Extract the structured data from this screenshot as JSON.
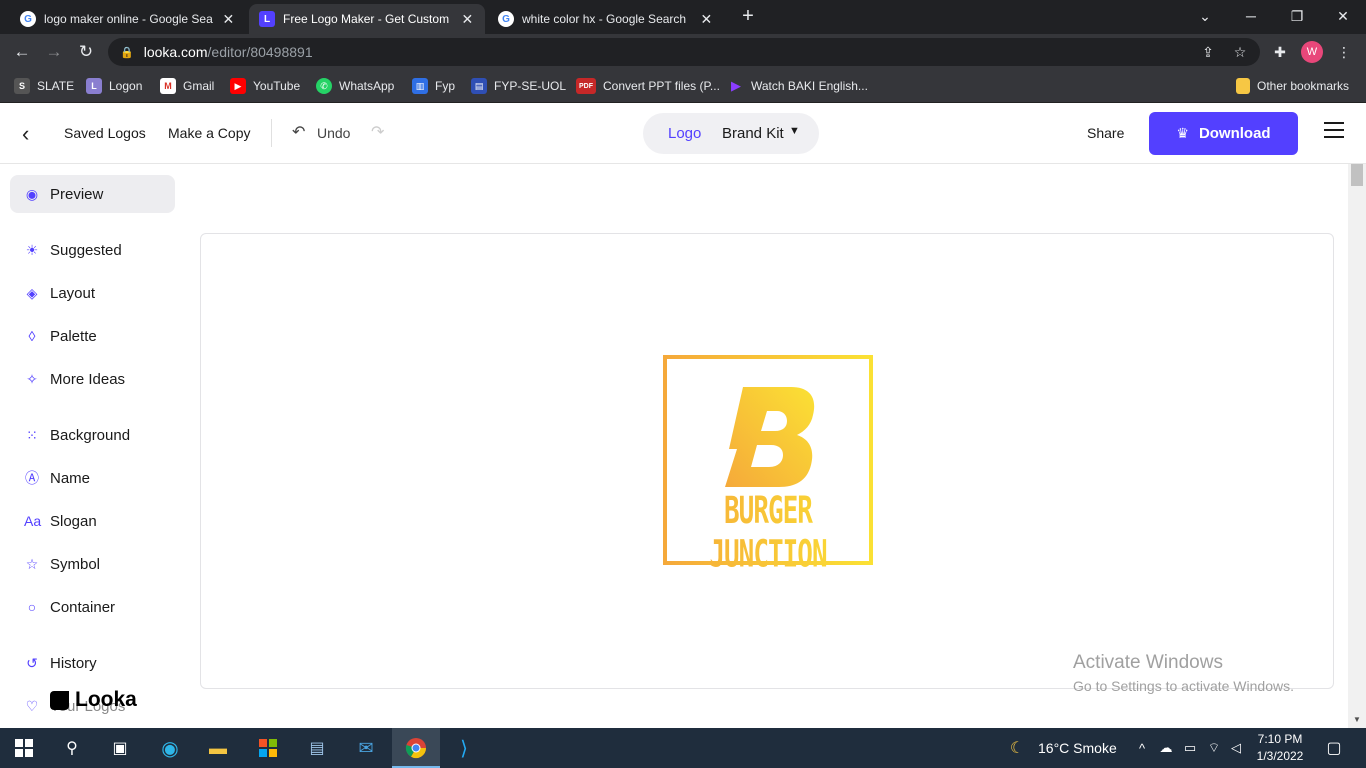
{
  "browser": {
    "tabs": [
      {
        "title": "logo maker online - Google Search",
        "favicon": "google-icon"
      },
      {
        "title": "Free Logo Maker - Get Custom Logo",
        "favicon": "looka-icon"
      },
      {
        "title": "white color hx - Google Search",
        "favicon": "google-icon"
      }
    ],
    "url_host": "looka.com",
    "url_path": "/editor/80498891",
    "profile_initial": "W",
    "bookmarks": [
      "SLATE",
      "Logon",
      "Gmail",
      "YouTube",
      "WhatsApp",
      "Fyp",
      "FYP-SE-UOL",
      "Convert PPT files (P...",
      "Watch BAKI English..."
    ],
    "other_bookmarks": "Other bookmarks"
  },
  "header": {
    "saved_logos": "Saved Logos",
    "make_copy": "Make a Copy",
    "undo": "Undo",
    "toggle_logo": "Logo",
    "toggle_brand_kit": "Brand Kit",
    "share": "Share",
    "download": "Download",
    "accent_color": "#5340ff"
  },
  "sidebar": {
    "items": [
      {
        "label": "Preview",
        "icon": "eye-icon"
      },
      {
        "label": "Suggested",
        "icon": "lightbulb-icon"
      },
      {
        "label": "Layout",
        "icon": "layers-icon"
      },
      {
        "label": "Palette",
        "icon": "droplet-icon"
      },
      {
        "label": "More Ideas",
        "icon": "magic-wand-icon"
      },
      {
        "label": "Background",
        "icon": "grid-dots-icon"
      },
      {
        "label": "Name",
        "icon": "text-box-icon"
      },
      {
        "label": "Slogan",
        "icon": "font-size-icon"
      },
      {
        "label": "Symbol",
        "icon": "star-icon"
      },
      {
        "label": "Container",
        "icon": "circle-icon"
      },
      {
        "label": "History",
        "icon": "history-icon"
      },
      {
        "label": "Your Logos",
        "icon": "heart-icon"
      }
    ],
    "brand": "Looka"
  },
  "canvas": {
    "logo_name": "BURGER JUNCTION",
    "logo_gradient": [
      "#f5a93a",
      "#fbe134"
    ]
  },
  "watermark": {
    "line1": "Activate Windows",
    "line2": "Go to Settings to activate Windows."
  },
  "taskbar": {
    "weather": "16°C  Smoke",
    "time": "7:10 PM",
    "date": "1/3/2022"
  }
}
